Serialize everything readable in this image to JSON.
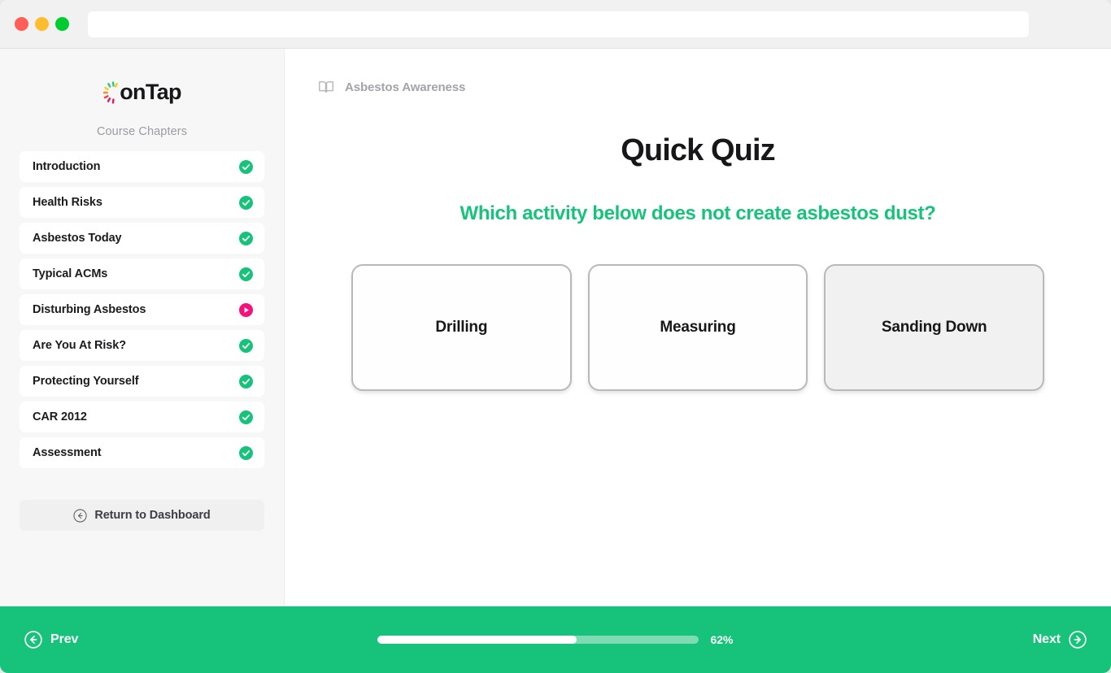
{
  "browser": {
    "traffic_lights": [
      {
        "name": "close",
        "color": "#FF5F57"
      },
      {
        "name": "minimize",
        "color": "#FFBD2E"
      },
      {
        "name": "maximize",
        "color": "#00CC2F"
      }
    ],
    "address_bar_value": "",
    "address_bar_placeholder": ""
  },
  "sidebar": {
    "logo_text": "onTap",
    "section_title": "Course Chapters",
    "chapters": [
      {
        "label": "Introduction",
        "status": "complete"
      },
      {
        "label": "Health Risks",
        "status": "complete"
      },
      {
        "label": "Asbestos Today",
        "status": "complete"
      },
      {
        "label": "Typical ACMs",
        "status": "complete"
      },
      {
        "label": "Disturbing Asbestos",
        "status": "current"
      },
      {
        "label": "Are You At Risk?",
        "status": "complete"
      },
      {
        "label": "Protecting Yourself",
        "status": "complete"
      },
      {
        "label": "CAR 2012",
        "status": "complete"
      },
      {
        "label": "Assessment",
        "status": "complete"
      }
    ],
    "return_button": "Return to Dashboard"
  },
  "main": {
    "breadcrumb": "Asbestos Awareness",
    "quiz_title": "Quick Quiz",
    "question": "Which activity below does not create asbestos dust?",
    "answers": [
      {
        "label": "Drilling",
        "selected": false
      },
      {
        "label": "Measuring",
        "selected": false
      },
      {
        "label": "Sanding Down",
        "selected": true
      }
    ]
  },
  "footer": {
    "prev_label": "Prev",
    "next_label": "Next",
    "progress_percent": 62,
    "progress_label": "62%"
  },
  "colors": {
    "accent_green": "#17C37B",
    "accent_pink": "#F5107B",
    "sidebar_bg": "#F7F7F8",
    "text_dark": "#17171A",
    "text_muted": "#A3A3A9"
  }
}
